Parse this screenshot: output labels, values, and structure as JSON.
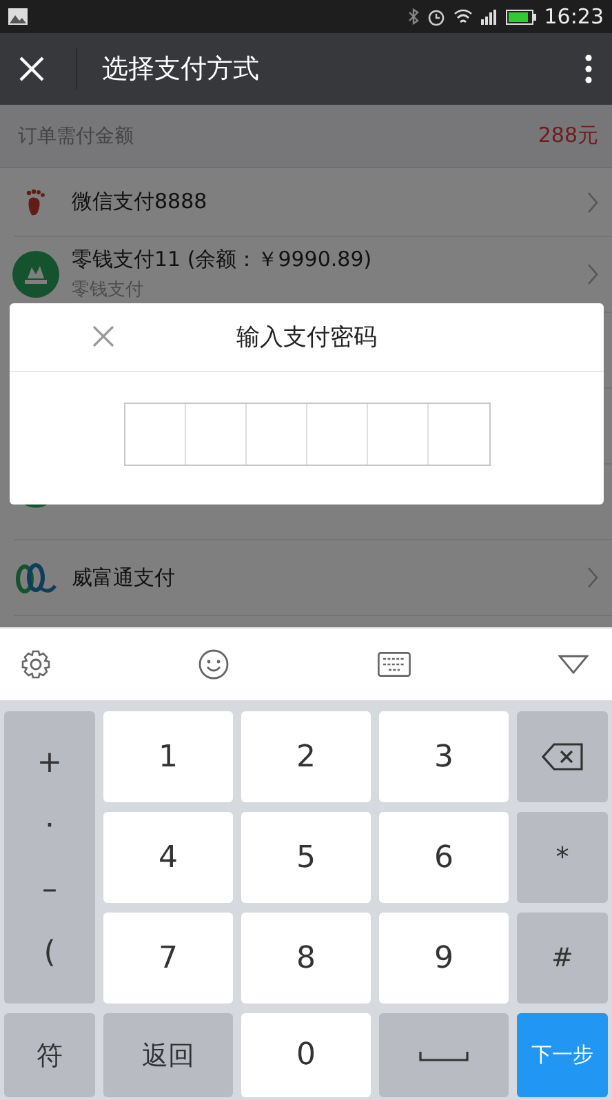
{
  "status_bar": {
    "time": "16:23"
  },
  "toolbar": {
    "title": "选择支付方式"
  },
  "order": {
    "label": "订单需付金额",
    "amount": "288元"
  },
  "payment_methods": [
    {
      "kind": "wechat",
      "name": "微信支付8888"
    },
    {
      "kind": "wallet",
      "name": "零钱支付11 (余额：￥9990.89)",
      "subtitle": "零钱支付"
    },
    {
      "kind": "hidden"
    },
    {
      "kind": "hidden"
    },
    {
      "kind": "ring"
    },
    {
      "kind": "swirl",
      "name": "威富通支付"
    }
  ],
  "dialog": {
    "title": "输入支付密码"
  },
  "keyboard": {
    "side_keys": [
      "+",
      "·",
      "–",
      "("
    ],
    "keys": [
      {
        "kind": "digit",
        "label": "1"
      },
      {
        "kind": "digit",
        "label": "2"
      },
      {
        "kind": "digit",
        "label": "3"
      },
      {
        "kind": "backspace"
      },
      {
        "kind": "digit",
        "label": "4"
      },
      {
        "kind": "digit",
        "label": "5"
      },
      {
        "kind": "digit",
        "label": "6"
      },
      {
        "kind": "function",
        "label": "*"
      },
      {
        "kind": "digit",
        "label": "7"
      },
      {
        "kind": "digit",
        "label": "8"
      },
      {
        "kind": "digit",
        "label": "9"
      },
      {
        "kind": "function",
        "label": "#"
      },
      {
        "kind": "function",
        "label": "符"
      },
      {
        "kind": "function",
        "label": "返回"
      },
      {
        "kind": "digit",
        "label": "0"
      },
      {
        "kind": "space"
      },
      {
        "kind": "primary",
        "label": "下一步"
      }
    ]
  }
}
